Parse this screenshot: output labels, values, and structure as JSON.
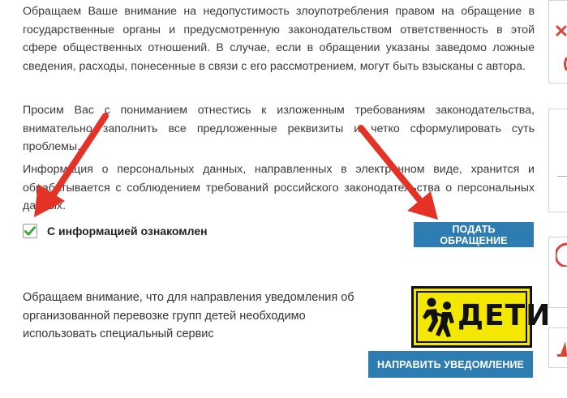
{
  "legal": {
    "paragraph_1": "Обращаем Ваше внимание на недопустимость злоупотребления правом на обращение в государственные органы и предусмотренную законодательством ответственность в этой сфере общественных отношений. В случае, если в обращении указаны заведомо ложные сведения, расходы, понесенные в связи с его рассмотрением, могут быть взысканы с автора.",
    "paragraph_2": "Просим Вас с пониманием отнестись к изложенным требованиям законодательства, внимательно заполнить все предложенные реквизиты и четко сформулировать суть проблемы.",
    "paragraph_3": "Информация о персональных данных, направленных в электронном виде, хранится и обрабатывается с соблюдением требований российского законодательства о персональных данных."
  },
  "agreement": {
    "label": "С информацией ознакомлен",
    "checked": true
  },
  "actions": {
    "submit_label": "ПОДАТЬ ОБРАЩЕНИЕ",
    "notify_label": "НАПРАВИТЬ УВЕДОМЛЕНИЕ"
  },
  "children_transport": {
    "notice": "Обращаем внимание, что для направления уведомления об организованной перевозке групп детей необходимо использовать специальный сервис",
    "banner_text": "ДЕТИ"
  },
  "colors": {
    "button": "#2d7db3",
    "arrow": "#e53227",
    "check": "#3aa53a",
    "banner": "#f5e800"
  },
  "icons": [
    "checkmark-icon",
    "children-sign-icon",
    "arrow-annotation-icon"
  ]
}
